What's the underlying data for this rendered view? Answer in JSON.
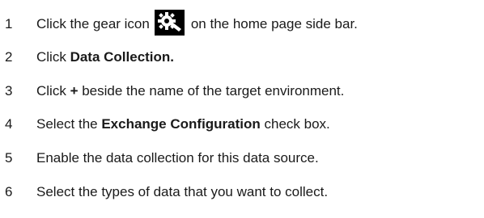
{
  "steps": [
    {
      "number": "1",
      "before": "Click the gear icon",
      "after": "on the home page side bar.",
      "icon": "gear-icon"
    },
    {
      "number": "2",
      "prefix": "Click ",
      "bold": "Data Collection."
    },
    {
      "number": "3",
      "prefix": "Click ",
      "bold": "+",
      "suffix": " beside the name of the target environment."
    },
    {
      "number": "4",
      "prefix": "Select the ",
      "bold": "Exchange Configuration",
      "suffix": " check box."
    },
    {
      "number": "5",
      "text": "Enable the data collection for this data source."
    },
    {
      "number": "6",
      "text": "Select the types of data that you want to collect."
    }
  ],
  "colors": {
    "text": "#1a1a1a",
    "icon_bg": "#000000",
    "icon_fg": "#ffffff"
  }
}
